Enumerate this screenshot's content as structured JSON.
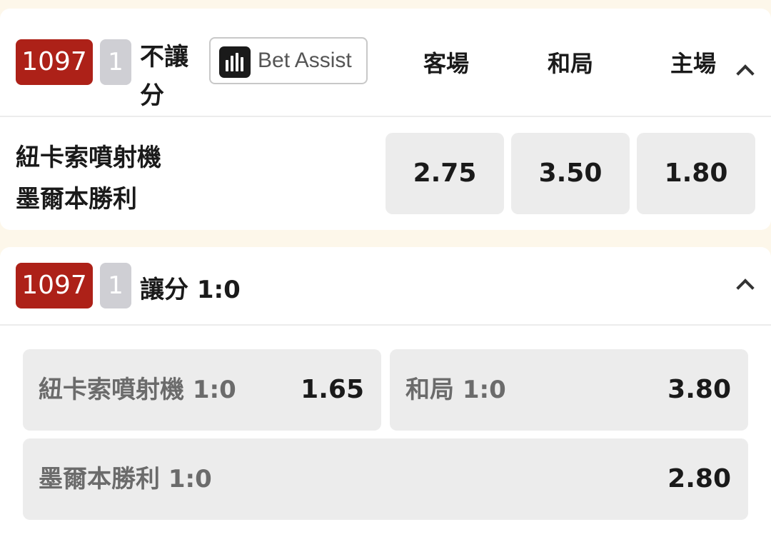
{
  "market1": {
    "pool_number": "1097",
    "leg_number": "1",
    "title_line1": "不讓",
    "title_line2": "分",
    "bet_assist_label": "Bet Assist",
    "columns": [
      "客場",
      "和局",
      "主場"
    ],
    "away_team": "紐卡索噴射機",
    "home_team": "墨爾本勝利",
    "odds": [
      "2.75",
      "3.50",
      "1.80"
    ]
  },
  "market2": {
    "pool_number": "1097",
    "leg_number": "1",
    "title": "讓分 1:0",
    "selections": [
      {
        "name": "紐卡索噴射機 1:0",
        "price": "1.65"
      },
      {
        "name": "和局 1:0",
        "price": "3.80"
      },
      {
        "name": "墨爾本勝利 1:0",
        "price": "2.80"
      }
    ]
  },
  "icons": [
    "bar-chart-icon",
    "chevron-up-icon"
  ],
  "colors": {
    "accent": "#ad2118",
    "leg_badge": "#cfcfd4",
    "button": "#ececec",
    "background": "#fdf7ea"
  }
}
